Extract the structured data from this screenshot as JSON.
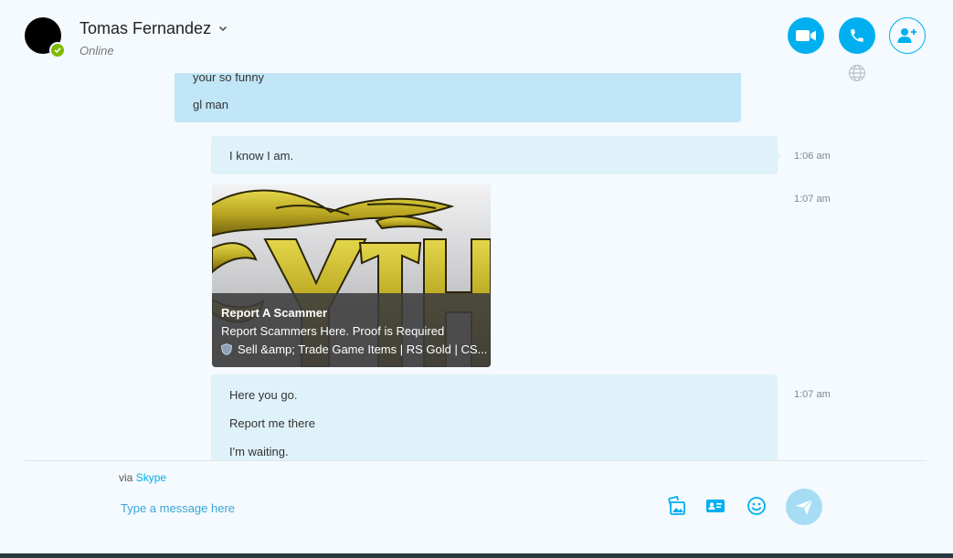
{
  "contact": {
    "name": "Tomas Fernandez",
    "status": "Online",
    "presence_color": "#7fba00"
  },
  "header_actions": [
    {
      "name": "video-call-button",
      "icon": "video-camera-icon"
    },
    {
      "name": "audio-call-button",
      "icon": "phone-icon"
    },
    {
      "name": "add-people-button",
      "icon": "add-person-icon"
    }
  ],
  "messages": {
    "incoming": {
      "lines": [
        "your so funny",
        "gl man"
      ]
    },
    "outgoing_1": {
      "lines": [
        "I know I am."
      ],
      "time": "1:06 am"
    },
    "link_preview": {
      "time": "1:07 am",
      "title": "Report A Scammer",
      "description": "Report Scammers Here. Proof is Required",
      "site": "Sell &amp; Trade Game Items | RS Gold | CS..."
    },
    "outgoing_2": {
      "lines": [
        "Here you go.",
        "Report me there",
        "I'm waiting."
      ],
      "time": "1:07 am"
    }
  },
  "composer": {
    "via_prefix": "via",
    "via_link": "Skype",
    "placeholder": "Type a message here"
  },
  "colors": {
    "accent": "#00aff0",
    "incoming_bubble": "#c1e6f7",
    "outgoing_bubble": "#dff2fa",
    "background": "#f4fafd"
  }
}
